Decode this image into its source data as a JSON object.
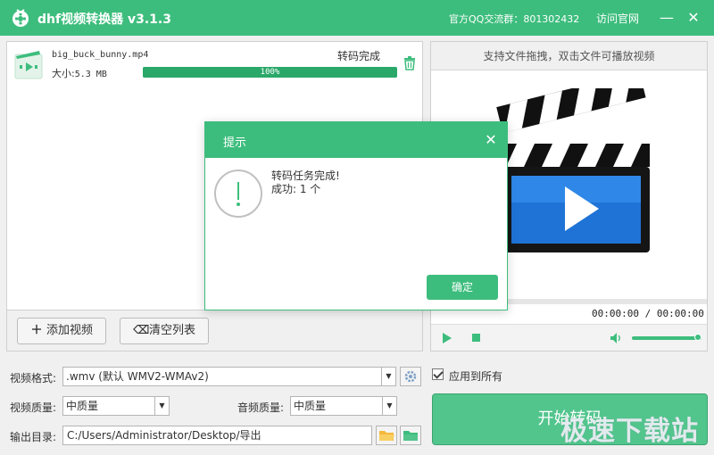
{
  "app": {
    "title": "dhf视频转换器 v3.1.3",
    "qq_group": "官方QQ交流群：801302432",
    "website_link": "访问官网",
    "minimize_glyph": "—",
    "close_glyph": "✕"
  },
  "file_list": {
    "items": [
      {
        "name": "big_buck_bunny.mp4",
        "size_label": "大小:",
        "size": "5.3 MB",
        "status": "转码完成",
        "progress": 100,
        "progress_text": "100%"
      }
    ],
    "add_button": "添加视频",
    "clear_button": "清空列表"
  },
  "preview": {
    "hint": "支持文件拖拽，双击文件可播放视频",
    "time": "00:00:00 / 00:00:00",
    "volume": 0.95
  },
  "settings": {
    "format_label": "视频格式:",
    "format_value": ".wmv (默认 WMV2-WMAv2)",
    "apply_all_label": "应用到所有",
    "apply_all_checked": true,
    "video_quality_label": "视频质量:",
    "video_quality_value": "中质量",
    "audio_quality_label": "音频质量:",
    "audio_quality_value": "中质量",
    "output_label": "输出目录:",
    "output_value": "C:/Users/Administrator/Desktop/导出",
    "start_button": "开始转码"
  },
  "watermark": "极速下载站",
  "dialog": {
    "title": "提示",
    "close_glyph": "✕",
    "message_line1": "转码任务完成!",
    "message_line2": "成功:  1 个",
    "ok_button": "确定"
  },
  "colors": {
    "accent": "#3dbd7d",
    "start_button": "#52c58d"
  },
  "icons": {
    "logo": "film-reel-icon",
    "file_thumb": "video-file-icon",
    "trash": "trash-icon",
    "clapper": "clapperboard-play-icon",
    "play": "play-icon",
    "stop": "stop-icon",
    "volume": "speaker-icon",
    "format_settings": "gear-icon",
    "folder_open": "folder-open-icon",
    "folder_view": "folder-icon",
    "info": "exclamation-circle-icon"
  }
}
